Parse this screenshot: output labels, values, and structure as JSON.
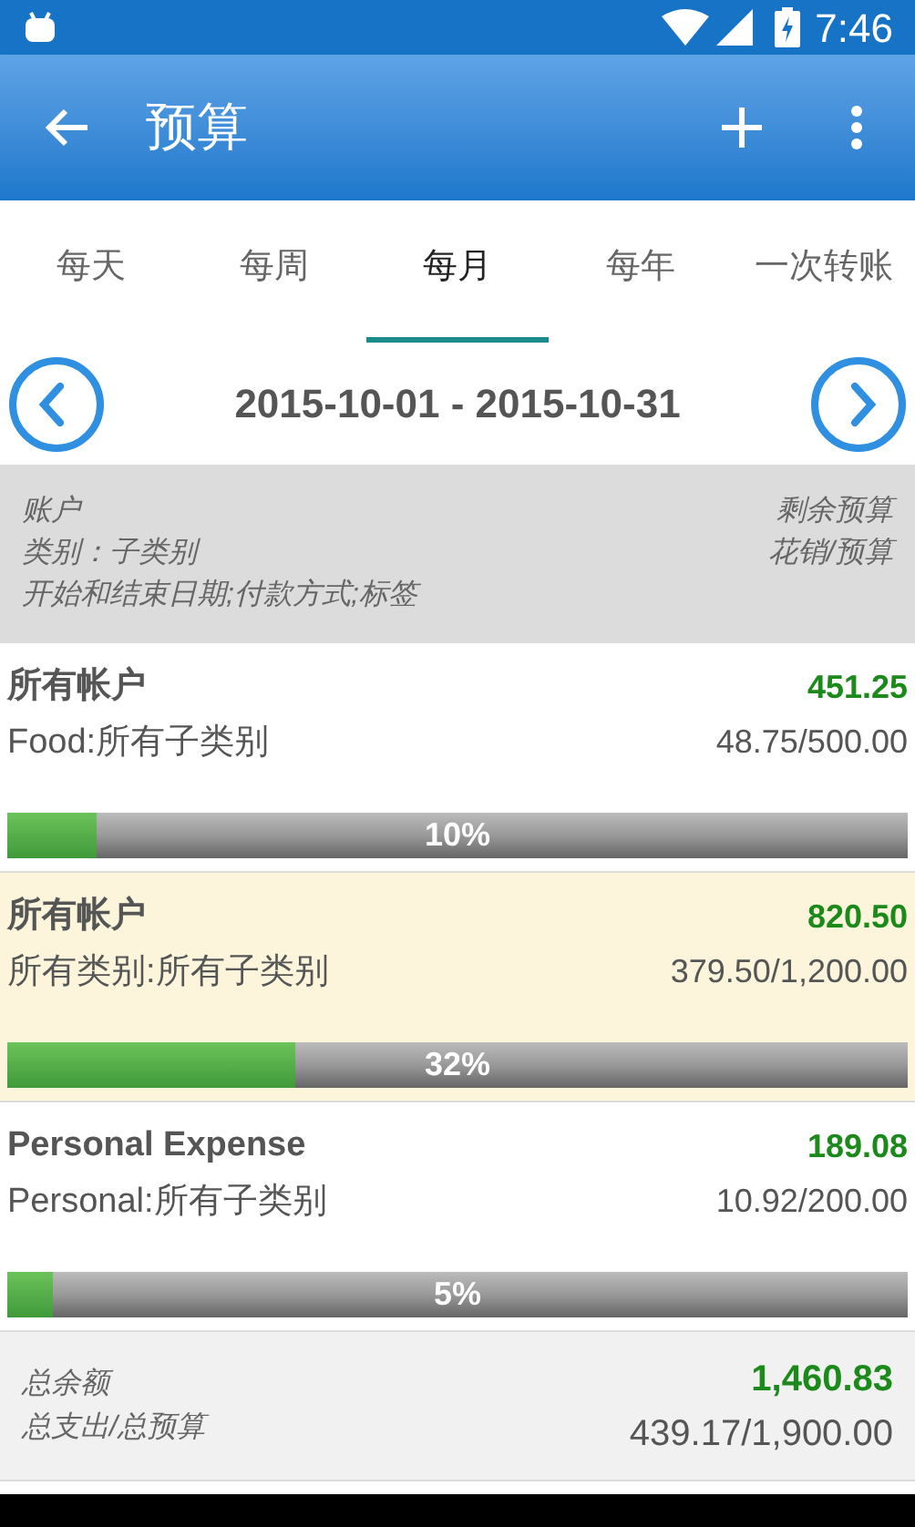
{
  "status_bar": {
    "time": "7:46"
  },
  "app_bar": {
    "title": "预算"
  },
  "tabs": [
    {
      "label": "每天",
      "selected": false
    },
    {
      "label": "每周",
      "selected": false
    },
    {
      "label": "每月",
      "selected": true
    },
    {
      "label": "每年",
      "selected": false
    },
    {
      "label": "一次转账",
      "selected": false
    }
  ],
  "period": {
    "range": "2015-10-01 - 2015-10-31"
  },
  "legend": {
    "left": [
      "账户",
      "类别：子类别",
      "开始和结束日期;付款方式;标签"
    ],
    "right": [
      "剩余预算",
      "花销/预算"
    ]
  },
  "budgets": [
    {
      "account": "所有帐户",
      "category": "Food:所有子类别",
      "remaining": "451.25",
      "spent": "48.75/500.00",
      "level": 0.1,
      "percent": "10%",
      "selected": false
    },
    {
      "account": "所有帐户",
      "category": "所有类别:所有子类别",
      "remaining": "820.50",
      "spent": "379.50/1,200.00",
      "level": 0.32,
      "percent": "32%",
      "selected": true
    },
    {
      "account": "Personal Expense",
      "category": "Personal:所有子类别",
      "remaining": "189.08",
      "spent": "10.92/200.00",
      "level": 0.05,
      "percent": "5%",
      "selected": false
    }
  ],
  "totals": {
    "balance_label": "总余额",
    "balance": "1,460.83",
    "spent_label": "总支出/总预算",
    "spent": "439.17/1,900.00"
  }
}
